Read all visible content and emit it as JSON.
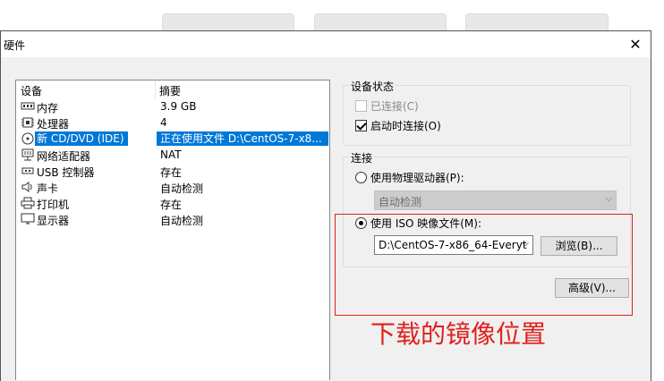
{
  "dialog": {
    "title": "硬件"
  },
  "device_list": {
    "headers": {
      "device": "设备",
      "summary": "摘要"
    },
    "rows": [
      {
        "icon": "memory-icon",
        "name": "内存",
        "summary": "3.9 GB"
      },
      {
        "icon": "cpu-icon",
        "name": "处理器",
        "summary": "4"
      },
      {
        "icon": "cd-dvd-icon",
        "name": "新 CD/DVD (IDE)",
        "summary": "正在使用文件 D:\\CentOS-7-x8..."
      },
      {
        "icon": "network-icon",
        "name": "网络适配器",
        "summary": "NAT"
      },
      {
        "icon": "usb-icon",
        "name": "USB 控制器",
        "summary": "存在"
      },
      {
        "icon": "sound-icon",
        "name": "声卡",
        "summary": "自动检测"
      },
      {
        "icon": "printer-icon",
        "name": "打印机",
        "summary": "存在"
      },
      {
        "icon": "display-icon",
        "name": "显示器",
        "summary": "自动检测"
      }
    ],
    "selected_index": 2
  },
  "device_status": {
    "label": "设备状态",
    "connected": {
      "label": "已连接(C)",
      "checked": false,
      "enabled": false
    },
    "connect_at_power_on": {
      "label": "启动时连接(O)",
      "checked": true
    }
  },
  "connection": {
    "label": "连接",
    "physical_drive": {
      "label": "使用物理驱动器(P):",
      "selected": false,
      "dropdown_value": "自动检测"
    },
    "iso_image": {
      "label": "使用 ISO 映像文件(M):",
      "selected": true,
      "path": "D:\\CentOS-7-x86_64-Everyt"
    },
    "browse_label": "浏览(B)..."
  },
  "advanced_label": "高级(V)...",
  "annotation": {
    "text": "下载的镜像位置",
    "color": "#e0201c"
  },
  "colors": {
    "selection": "#0078d7"
  }
}
